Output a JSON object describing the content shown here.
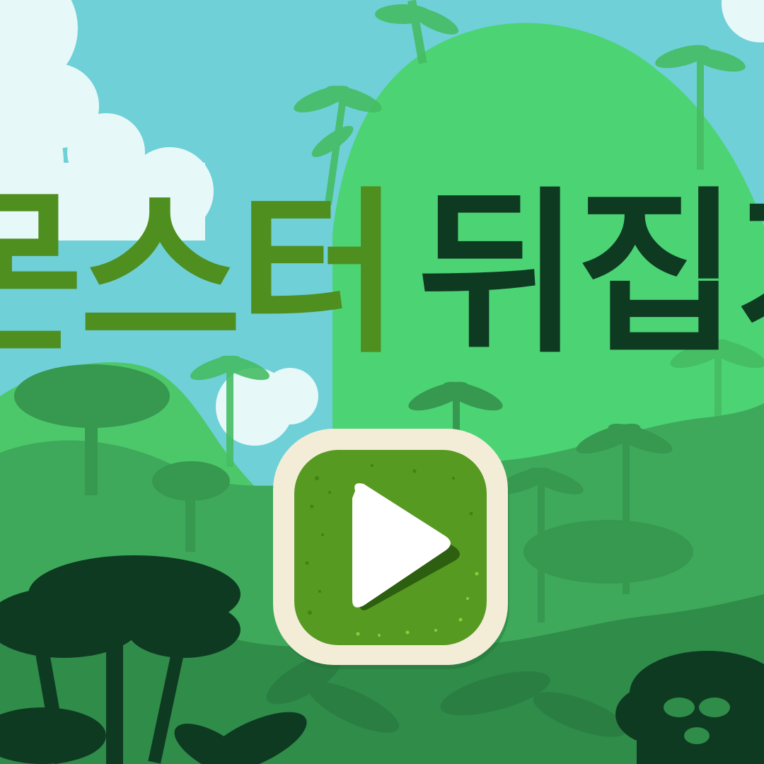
{
  "title": {
    "part_light": "몬스터",
    "part_dark": "뒤집기"
  },
  "play_button": {
    "icon": "play-icon"
  },
  "colors": {
    "sky": "#6fd0d8",
    "cloud": "#e6f8f8",
    "hill": "#4cd374",
    "title_light": "#4f8f1f",
    "title_dark": "#0f3a22",
    "button_frame": "#f3edd8",
    "button_face": "#569a22",
    "play_triangle": "#ffffff"
  }
}
